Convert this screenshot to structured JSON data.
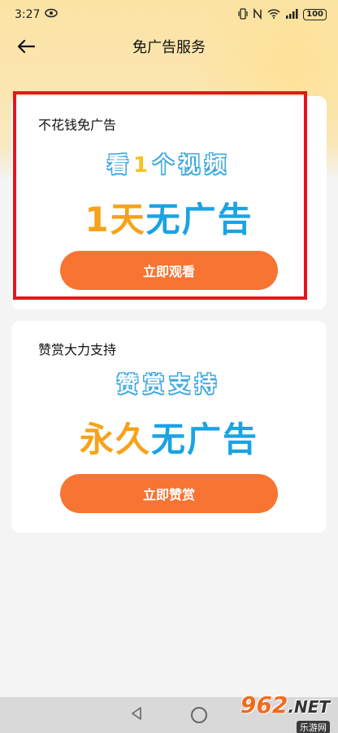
{
  "status_bar": {
    "time": "3:27",
    "battery": "100"
  },
  "header": {
    "title": "免广告服务"
  },
  "cards": [
    {
      "title": "不花钱免广告",
      "headline_top_prefix": "看",
      "headline_top_number": "1",
      "headline_top_suffix": "个视频",
      "headline_bottom_orange": "1天",
      "headline_bottom_blue": "无广告",
      "button_label": "立即观看"
    },
    {
      "title": "赞赏大力支持",
      "headline_top": "赞赏支持",
      "headline_bottom_orange": "永久",
      "headline_bottom_blue": "无广告",
      "button_label": "立即赞赏"
    }
  ],
  "watermark": {
    "logo_number": "962",
    "logo_suffix": ".NET",
    "subtitle": "乐游网"
  },
  "colors": {
    "accent_button": "#f77433",
    "highlight_orange": "#f6a21a",
    "highlight_blue": "#1aa3e3",
    "annotation_red": "#e8141c"
  }
}
